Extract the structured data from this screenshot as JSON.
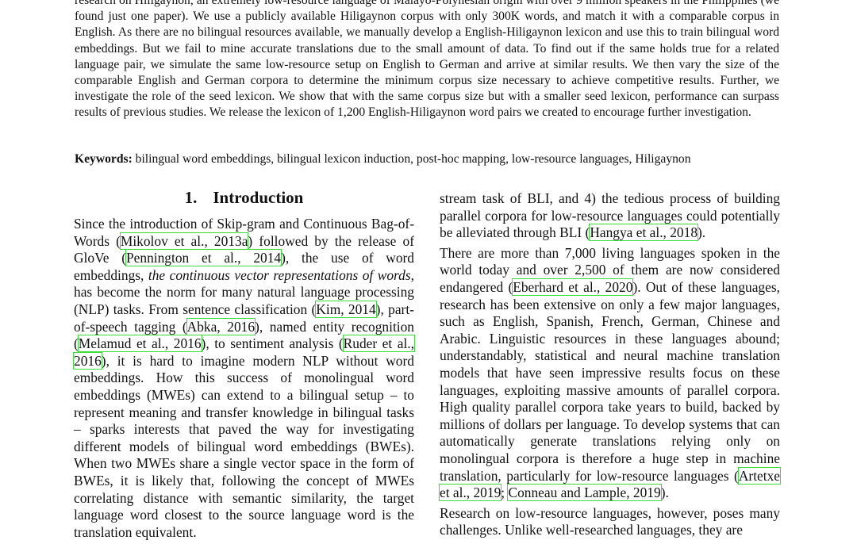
{
  "abstract": {
    "text": "research on Hiligaynon, an extremely low-resource language of Malayo-Polynesian origin with over 9 million speakers in the Philippines (we found just one paper).  We use a publicly available Hiligaynon corpus with only 300K words, and match it with a comparable corpus in English. As there are no bilingual resources available, we manually develop a English-Hiligaynon lexicon and use this to train bilingual word embeddings. But we fail to mine accurate translations due to the small amount of data. To find out if the same holds true for a related language pair, we simulate the same low-resource setup on English to German and arrive at similar results.  We then vary the size of the comparable English and German corpora to determine the minimum corpus size necessary to achieve competitive results. Further, we investigate the role of the seed lexicon. We show that with the same corpus size but with a smaller seed lexicon, performance can surpass results of previous studies.  We release the lexicon of 1,200 English-Hiligaynon word pairs we created to encourage further investigation."
  },
  "keywords": {
    "label": "Keywords:",
    "text": " bilingual word embeddings, bilingual lexicon induction, post-hoc mapping, low-resource languages, Hiligaynon"
  },
  "section": {
    "number": "1.",
    "title": "Introduction"
  },
  "left_column": {
    "t1": "Since the introduction of Skip-gram and Continuous Bag-of-Words (",
    "c1": "Mikolov et al., 2013a",
    "t2": ") followed by the release of GloVe (",
    "c2": "Pennington et al., 2014",
    "t3": "), the use of word embeddings, ",
    "em1": "the continuous vector representations of words",
    "t4": ", has become the norm for many natural language processing (NLP) tasks. From sentence classification (",
    "c3": "Kim, 2014",
    "t5": "), part-of-speech tagging (",
    "c4": "Abka, 2016",
    "t6": "), named entity recognition (",
    "c5": "Melamud et al., 2016",
    "t7": "), to sentiment analysis (",
    "c6": "Ruder et al., 2016",
    "t8": "), it is hard to imagine modern NLP without word embeddings. How this success of monolingual word embeddings (MWEs) can extend to a bilingual setup – to represent meaning and transfer knowledge in bilingual tasks – sparks interests that paved the way for investigating different models of bilingual word embeddings (BWEs). When two MWEs share a single vector space in the form of BWEs, it is likely that, following the concept of MWEs correlating distance with semantic similarity, the target language word closest to the source language word is the translation equivalent."
  },
  "right_column": {
    "p1_t1": "stream task of BLI, and 4) the tedious process of building parallel corpora for low-resource languages could potentially be alleviated through BLI (",
    "p1_c1": "Hangya et al., 2018",
    "p1_t2": ").",
    "p2_t1": "There are more than 7,000 living languages spoken in the world today and over 2,500 of them are now considered endangered (",
    "p2_c1": "Eberhard et al., 2020",
    "p2_t2": ").  Out of these languages, research has been extensive on only a few major languages, such as English, Spanish, French, German, Chinese and Arabic.  Linguistic resources in these languages abound; understandably, statistical and neural machine translation models that have seen impressive results focus on these languages, exploiting massive amounts of parallel corpora. High quality parallel corpora take years to build, backed by millions of dollars per language.  To develop systems that can automatically generate translations relying only on monolingual corpora is therefore a huge step in machine translation, particularly for low-resource languages (",
    "p2_c2": "Artetxe et al., 2019",
    "p2_sep": "; ",
    "p2_c3": "Conneau and Lample, 2019",
    "p2_t3": ").",
    "p3_t1": "Research on low-resource languages, however, poses many challenges.  Unlike well-researched languages, they are"
  },
  "colors": {
    "citation_box": "#3ddc3d",
    "text": "#111111",
    "background": "#ffffff"
  }
}
